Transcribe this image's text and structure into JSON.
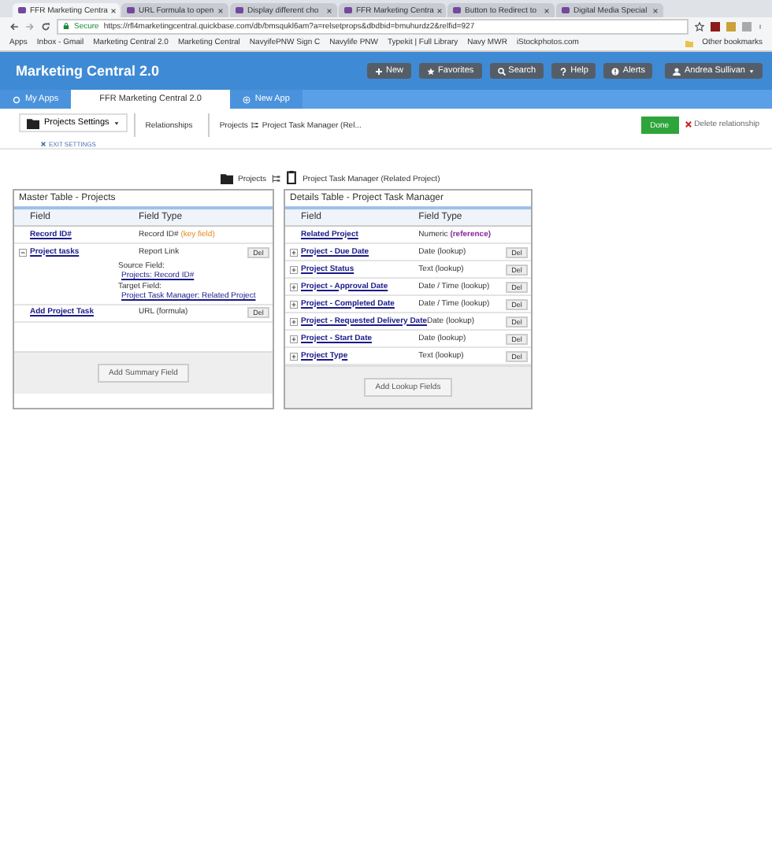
{
  "browser": {
    "tabs": [
      {
        "label": "FFR Marketing Centra",
        "selected": true
      },
      {
        "label": "URL Formula to open",
        "selected": false
      },
      {
        "label": "Display different cho",
        "selected": false
      },
      {
        "label": "FFR Marketing Centra",
        "selected": false
      },
      {
        "label": "Button to Redirect to",
        "selected": false
      },
      {
        "label": "Digital Media Special",
        "selected": false
      }
    ],
    "secure": "Secure",
    "url": "https://rfl4marketingcentral.quickbase.com/db/bmsqukl6am?a=relsetprops&dbdbid=bmuhurdz2&relfid=927",
    "bookmarks": [
      "Apps",
      "Inbox - Gmail",
      "Marketing Central 2.0",
      "Marketing Central",
      "NavyifePNW Sign C",
      "Navylife PNW",
      "Typekit | Full Library",
      "Navy MWR",
      "iStockphotos.com"
    ],
    "other_bookmarks": "Other bookmarks"
  },
  "app": {
    "title": "Marketing Central 2.0",
    "buttons": [
      {
        "label": "New",
        "kind": "plus"
      },
      {
        "label": "Favorites",
        "kind": "star"
      },
      {
        "label": "Search",
        "kind": "search"
      },
      {
        "label": "Help",
        "kind": "help"
      },
      {
        "label": "Alerts",
        "kind": "alert"
      }
    ],
    "user": "Andrea Sullivan",
    "nav": [
      {
        "label": "My Apps",
        "selected": false
      },
      {
        "label": "FFR Marketing Central 2.0",
        "selected": true
      },
      {
        "label": "New App",
        "selected": false
      }
    ]
  },
  "toolbar": {
    "settings": "Projects Settings",
    "exit": "EXIT SETTINGS",
    "breadcrumbs": [
      "Relationships",
      "Projects",
      "Project Task Manager (Rel..."
    ],
    "done": "Done",
    "delete": "Delete relationship"
  },
  "relationship": {
    "master": "Projects",
    "detail": "Project Task Manager (Related Project)"
  },
  "tables": [
    {
      "title": "Master Table - Projects",
      "columns": [
        "Field",
        "Field Type"
      ],
      "button": "Add Summary Field",
      "rows": [
        {
          "kind": "plain",
          "field": "Record ID#",
          "type": "Record ID#",
          "note": "(key field)"
        },
        {
          "kind": "report",
          "expanded": true,
          "field": "Project tasks",
          "type": "Report Link",
          "del": "Del",
          "source_label": "Source Field:",
          "source": "Projects: Record ID#",
          "target_label": "Target Field:",
          "target": "Project Task Manager: Related Project"
        },
        {
          "kind": "plain",
          "field": "Add Project Task",
          "type": "URL (formula)",
          "del": "Del"
        }
      ]
    },
    {
      "title": "Details Table - Project Task Manager",
      "columns": [
        "Field",
        "Field Type"
      ],
      "button": "Add Lookup Fields",
      "rows": [
        {
          "kind": "plain",
          "field": "Related Project",
          "type": "Numeric",
          "note": "(reference)"
        },
        {
          "kind": "lookup",
          "expanded": false,
          "field": "Project - Due Date",
          "type": "Date (lookup)",
          "del": "Del"
        },
        {
          "kind": "lookup",
          "expanded": false,
          "field": "Project Status",
          "type": "Text (lookup)",
          "del": "Del"
        },
        {
          "kind": "lookup",
          "expanded": false,
          "field": "Project - Approval Date",
          "type": "Date / Time (lookup)",
          "del": "Del"
        },
        {
          "kind": "lookup",
          "expanded": false,
          "field": "Project - Completed Date",
          "type": "Date / Time (lookup)",
          "del": "Del"
        },
        {
          "kind": "lookup",
          "expanded": false,
          "field": "Project - Requested Delivery Date",
          "type": "Date (lookup)",
          "del": "Del"
        },
        {
          "kind": "lookup",
          "expanded": false,
          "field": "Project - Start Date",
          "type": "Date (lookup)",
          "del": "Del"
        },
        {
          "kind": "lookup",
          "expanded": false,
          "field": "Project Type",
          "type": "Text (lookup)",
          "del": "Del"
        }
      ]
    }
  ]
}
